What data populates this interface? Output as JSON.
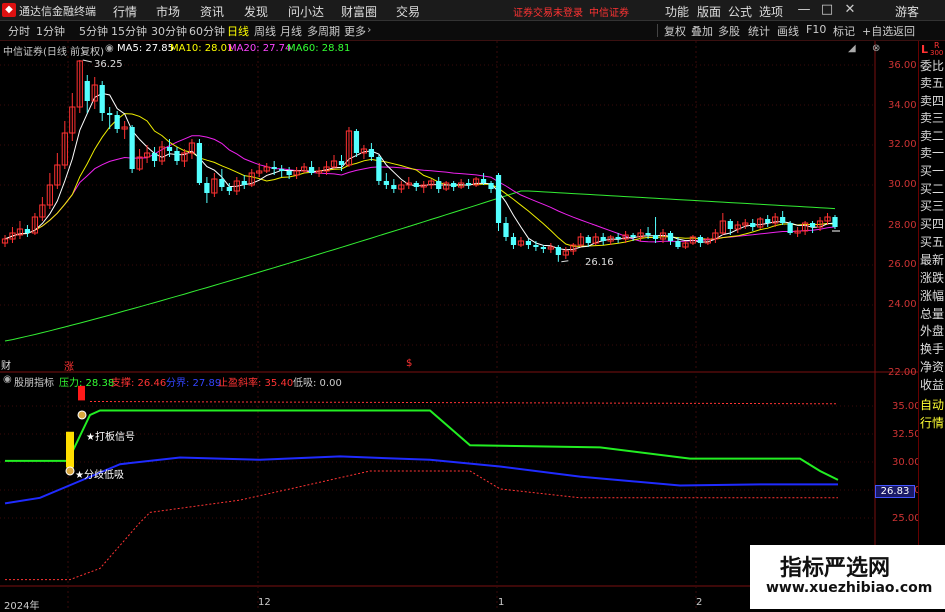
{
  "app": {
    "title": "通达信金融终端",
    "menu": [
      "行情",
      "市场",
      "资讯",
      "发现",
      "问小达",
      "财富圈",
      "交易"
    ],
    "login_notice": "证券交易未登录",
    "broker": "中信证券",
    "right_menu": [
      "功能",
      "版面",
      "公式",
      "选项"
    ],
    "user": "游客"
  },
  "toolbar": {
    "periods": [
      "分时",
      "1分钟",
      "5分钟",
      "15分钟",
      "30分钟",
      "60分钟",
      "日线",
      "周线",
      "月线",
      "多周期",
      "更多"
    ],
    "active_period": "日线",
    "tools": [
      "复权",
      "叠加",
      "多股",
      "统计",
      "画线",
      "F10",
      "标记",
      "+自选",
      "返回"
    ]
  },
  "main_chart": {
    "stock_label": "中信证券(日线 前复权)",
    "ma5": "MA5: 27.85",
    "ma10": "MA10: 28.01",
    "ma20": "MA20: 27.74",
    "ma60": "MA60: 28.81",
    "high_label": "36.25",
    "low_label": "26.16",
    "y_ticks": [
      "36.00",
      "34.00",
      "32.00",
      "30.00",
      "28.00",
      "26.00",
      "24.00",
      "22.00"
    ],
    "axis_top_label": "L",
    "axis_r_label": "R",
    "axis_scale_label": "300"
  },
  "indicator": {
    "name": "股朋指标",
    "pressure": "压力: 28.38",
    "support": "支撑: 26.46",
    "divide": "分界: 27.89",
    "stop": "止盈斜率: 35.40",
    "low_buy": "低吸: 0.00",
    "signal1": "★打板信号",
    "signal2": "★分歧低吸",
    "y_ticks": [
      "35.00",
      "32.50",
      "30.00",
      "27.50",
      "25.00"
    ],
    "current": "26.83"
  },
  "markers": {
    "cai": "财",
    "zhang": "涨",
    "s_marker": "$"
  },
  "x_axis": {
    "labels": [
      "2024年",
      "12",
      "1",
      "2"
    ]
  },
  "right_panel": [
    "委比",
    "卖五",
    "卖四",
    "卖三",
    "卖二",
    "卖一",
    "买一",
    "买二",
    "买三",
    "买四",
    "买五",
    "最新",
    "涨跌",
    "涨幅",
    "总量",
    "外盘",
    "换手",
    "净资",
    "收益",
    "自动",
    "行情"
  ],
  "watermark": {
    "title": "指标严选网",
    "url": "www.xuezhibiao.com"
  },
  "colors": {
    "up": "#ff3232",
    "down": "#54ffff",
    "ma5": "#ffffff",
    "ma10": "#ffff00",
    "ma20": "#ff00ff",
    "ma60": "#00ff00"
  }
}
